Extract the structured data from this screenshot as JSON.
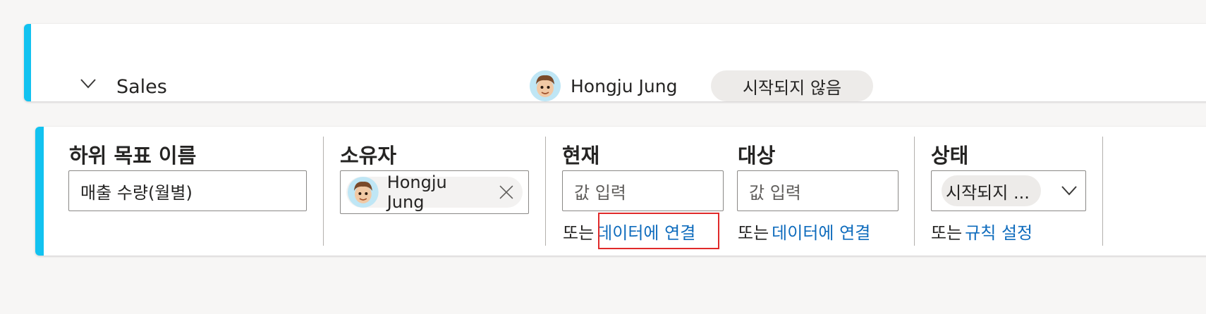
{
  "goal": {
    "name": "Sales",
    "owner": "Hongju Jung",
    "status": "시작되지 않음"
  },
  "subgoal_form": {
    "name": {
      "label": "하위 목표 이름",
      "value": "매출 수량(월별)"
    },
    "owner": {
      "label": "소유자",
      "value": "Hongju Jung"
    },
    "current": {
      "label": "현재",
      "placeholder": "값 입력",
      "or_text": "또는",
      "link": "데이터에 연결"
    },
    "target": {
      "label": "대상",
      "placeholder": "값 입력",
      "or_text": "또는",
      "link": "데이터에 연결"
    },
    "status": {
      "label": "상태",
      "value": "시작되지 ...",
      "or_text": "또는",
      "link": "규칙 설정"
    }
  },
  "colors": {
    "accent": "#12c2f0",
    "link": "#0f6cbd",
    "highlight": "#e02a2a"
  },
  "icons": [
    "chevron-down-icon",
    "avatar",
    "close-icon"
  ]
}
